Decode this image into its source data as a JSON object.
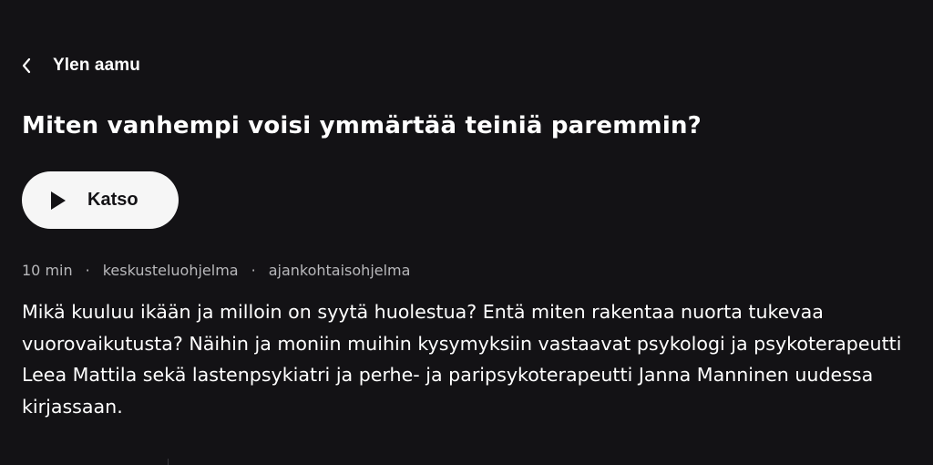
{
  "header": {
    "back_label": "Ylen aamu",
    "back_icon": "chevron-left-icon"
  },
  "program": {
    "title": "Miten vanhempi voisi ymmärtää teiniä paremmin?",
    "watch_label": "Katso",
    "watch_icon": "play-icon",
    "meta": {
      "duration": "10 min",
      "genre_1": "keskusteluohjelma",
      "genre_2": "ajankohtaisohjelma",
      "separator": "·"
    },
    "description": "Mikä kuuluu ikään ja milloin on syytä huolestua? Entä miten rakentaa nuorta tukevaa vuorovaikutusta? Näihin ja moniin muihin kysymyksiin vastaavat psykologi ja psykoterapeutti Leea Mattila sekä lastenpsykiatri ja perhe- ja paripsykoterapeutti Janna Manninen uudessa kirjassaan."
  },
  "colors": {
    "background": "#131215",
    "text": "#ffffff",
    "muted_text": "#b8b8bb",
    "button_bg": "#f6f6f6",
    "button_text": "#131215"
  }
}
